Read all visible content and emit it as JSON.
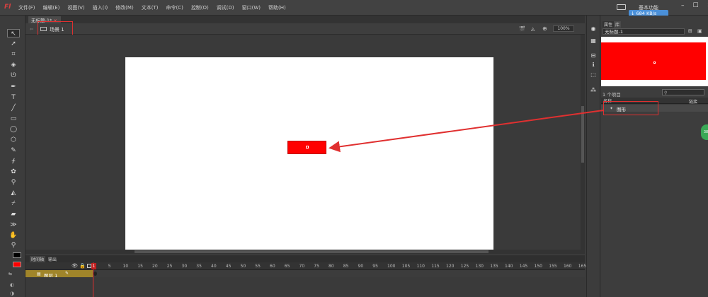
{
  "menubar": {
    "logo": "Fl",
    "items": [
      "文件(F)",
      "编辑(E)",
      "视图(V)",
      "插入(I)",
      "修改(M)",
      "文本(T)",
      "命令(C)",
      "控制(O)",
      "调试(D)",
      "窗口(W)",
      "帮助(H)"
    ],
    "workspace": "基本功能",
    "net_speed": "684 KB/s",
    "window_controls": [
      "–",
      "☐",
      "✕"
    ]
  },
  "document": {
    "tab_label": "无标题-1*",
    "tab_close": "×",
    "scene_label": "场景 1",
    "zoom": "100%"
  },
  "timeline": {
    "tabs": [
      "时间轴",
      "输出"
    ],
    "layer_name": "图层 1",
    "current_frame": "1",
    "ticks": [
      "1",
      "5",
      "10",
      "15",
      "20",
      "25",
      "30",
      "35",
      "40",
      "45",
      "50",
      "55",
      "60",
      "65",
      "70",
      "75",
      "80",
      "85",
      "90",
      "95",
      "100",
      "105",
      "110",
      "115",
      "120",
      "125",
      "130",
      "135",
      "140",
      "145",
      "150",
      "155",
      "160",
      "165"
    ]
  },
  "panel": {
    "tabs": [
      "属性",
      "库"
    ],
    "symbol_select": "无标题-1",
    "item_count": "1 个项目",
    "col_name": "名称",
    "col_link": "链接",
    "library_item": "图形"
  },
  "side_badge": "38",
  "colors": {
    "stage": "#ffffff",
    "rect_fill": "#ff0000",
    "annotation": "#e03030",
    "layer_row": "#a0852a"
  },
  "tools": [
    "selection-icon",
    "subselect-icon",
    "free-transform-icon",
    "3d-rotation-icon",
    "lasso-icon",
    "pen-icon",
    "text-icon",
    "line-icon",
    "rectangle-icon",
    "oval-icon",
    "polystar-icon",
    "pencil-icon",
    "brush-icon",
    "deco-icon",
    "bone-icon",
    "paint-bucket-icon",
    "ink-bottle-icon",
    "eyedropper-icon",
    "eraser-icon",
    "width-icon",
    "hand-icon",
    "zoom-icon"
  ]
}
